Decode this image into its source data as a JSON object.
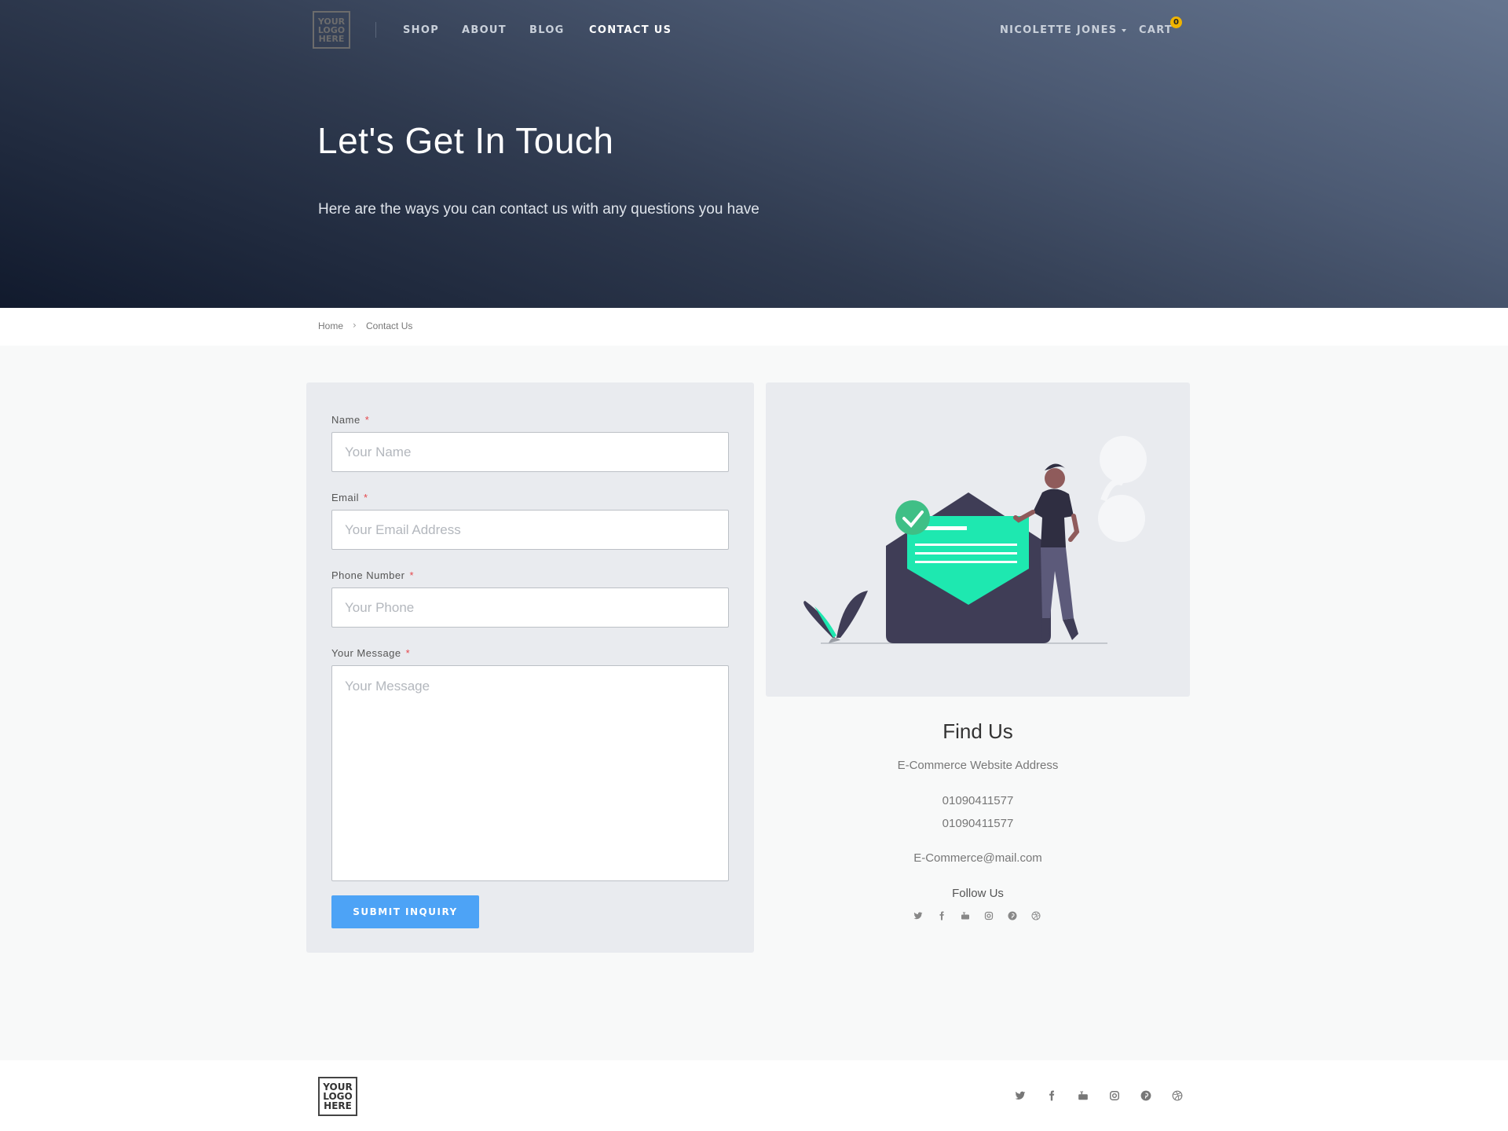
{
  "header": {
    "logo_text": "YOUR LOGO HERE",
    "nav": [
      {
        "label": "SHOP"
      },
      {
        "label": "ABOUT"
      },
      {
        "label": "BLOG"
      },
      {
        "label": "CONTACT US"
      }
    ],
    "user_name": "NICOLETTE JONES",
    "cart_label": "CART",
    "cart_count": "0"
  },
  "hero": {
    "title": "Let's Get In Touch",
    "subtitle": "Here are the ways you can contact us with any questions you have"
  },
  "breadcrumb": {
    "home": "Home",
    "separator": "›",
    "current": "Contact Us"
  },
  "form": {
    "name_label": "Name",
    "name_placeholder": "Your Name",
    "email_label": "Email",
    "email_placeholder": "Your Email Address",
    "phone_label": "Phone Number",
    "phone_placeholder": "Your Phone",
    "message_label": "Your Message",
    "message_placeholder": "Your Message",
    "required_mark": "*",
    "submit_label": "SUBMIT INQUIRY"
  },
  "find_us": {
    "title": "Find Us",
    "address": "E-Commerce Website Address",
    "phone_1": "01090411577",
    "phone_2": "01090411577",
    "email": "E-Commerce@mail.com",
    "follow_label": "Follow Us",
    "social_icons": [
      "twitter-icon",
      "facebook-icon",
      "youtube-icon",
      "instagram-icon",
      "pinterest-icon",
      "dribbble-icon"
    ]
  },
  "footer": {
    "logo_text": "YOUR LOGO HERE"
  },
  "colors": {
    "accent": "#4da3f6",
    "badge": "#f0b400",
    "illustration_green": "#1ee8b0",
    "required": "#e5484d"
  }
}
